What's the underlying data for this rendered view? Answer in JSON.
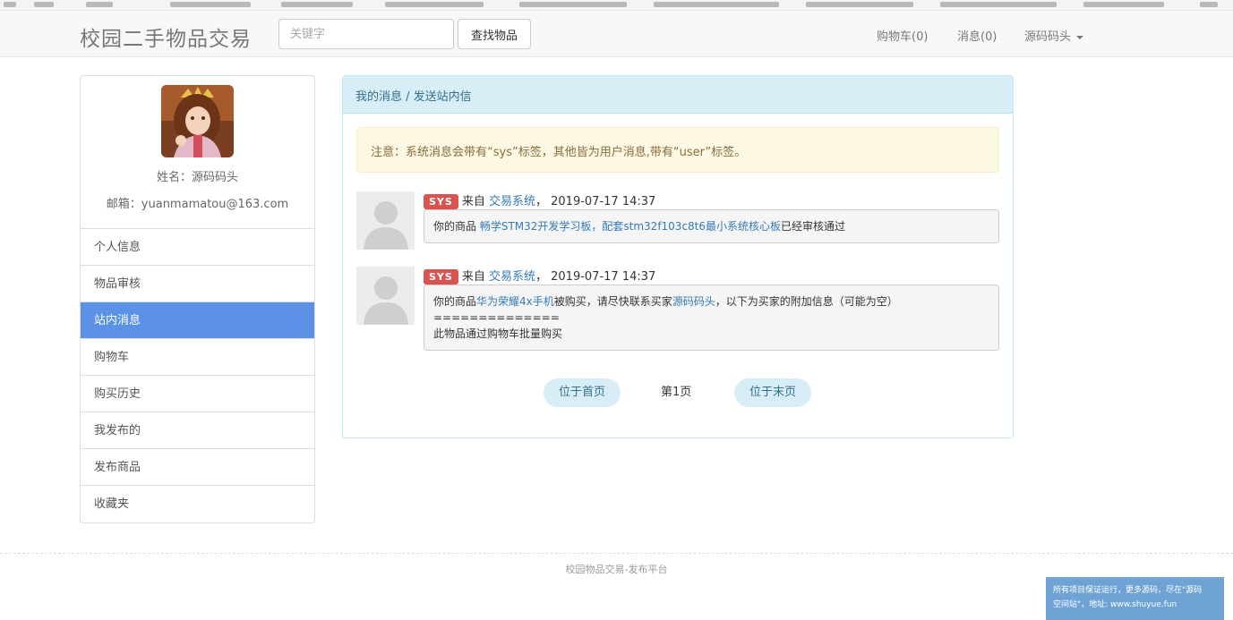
{
  "navbar": {
    "brand": "校园二手物品交易",
    "search_placeholder": "关键字",
    "search_button": "查找物品",
    "cart_label": "购物车(",
    "cart_count": "0",
    "messages_label": "消息(",
    "messages_count": "0",
    "close_paren": ")",
    "user_menu": "源码码头"
  },
  "sidebar": {
    "name_line": "姓名：源码码头",
    "email_line": "邮箱：yuanmamatou@163.com",
    "items": [
      {
        "label": "个人信息"
      },
      {
        "label": "物品审核"
      },
      {
        "label": "站内消息"
      },
      {
        "label": "购物车"
      },
      {
        "label": "购买历史"
      },
      {
        "label": "我发布的"
      },
      {
        "label": "发布商品"
      },
      {
        "label": "收藏夹"
      }
    ]
  },
  "panel": {
    "heading": "我的消息 / 发送站内信",
    "notice": "注意：系统消息会带有“sys”标签，其他皆为用户消息,带有“user”标签。"
  },
  "messages": [
    {
      "badge": "SYS",
      "from_prefix": "来自",
      "sender": "交易系统",
      "separator": "，",
      "time": "2019-07-17 14:37",
      "body_prefix": "你的商品 ",
      "item_link": "畅学STM32开发学习板，配套stm32f103c8t6最小系统核心板",
      "body_suffix": "已经审核通过"
    },
    {
      "badge": "SYS",
      "from_prefix": "来自",
      "sender": "交易系统",
      "separator": "，",
      "time": "2019-07-17 14:37",
      "body_prefix": "你的商品",
      "item_link": "华为荣耀4x手机",
      "body_mid": "被购买，请尽快联系买家",
      "buyer_link": "源码码头",
      "body_suffix": "，以下为买家的附加信息（可能为空）",
      "divider": "==============",
      "extra": "此物品通过购物车批量购买"
    }
  ],
  "pager": {
    "first": "位于首页",
    "current": "第1页",
    "last": "位于末页"
  },
  "footer": {
    "text": "校园物品交易-发布平台"
  },
  "watermark": {
    "line1": "所有项目保证运行，更多源码，尽在\"源码",
    "line2": "空间站\"，地址: www.shuyue.fun"
  },
  "colors": {
    "active_menu": "#5b92e5",
    "badge": "#d9534f",
    "link": "#337ab7",
    "panel_heading": "#d9edf7"
  }
}
